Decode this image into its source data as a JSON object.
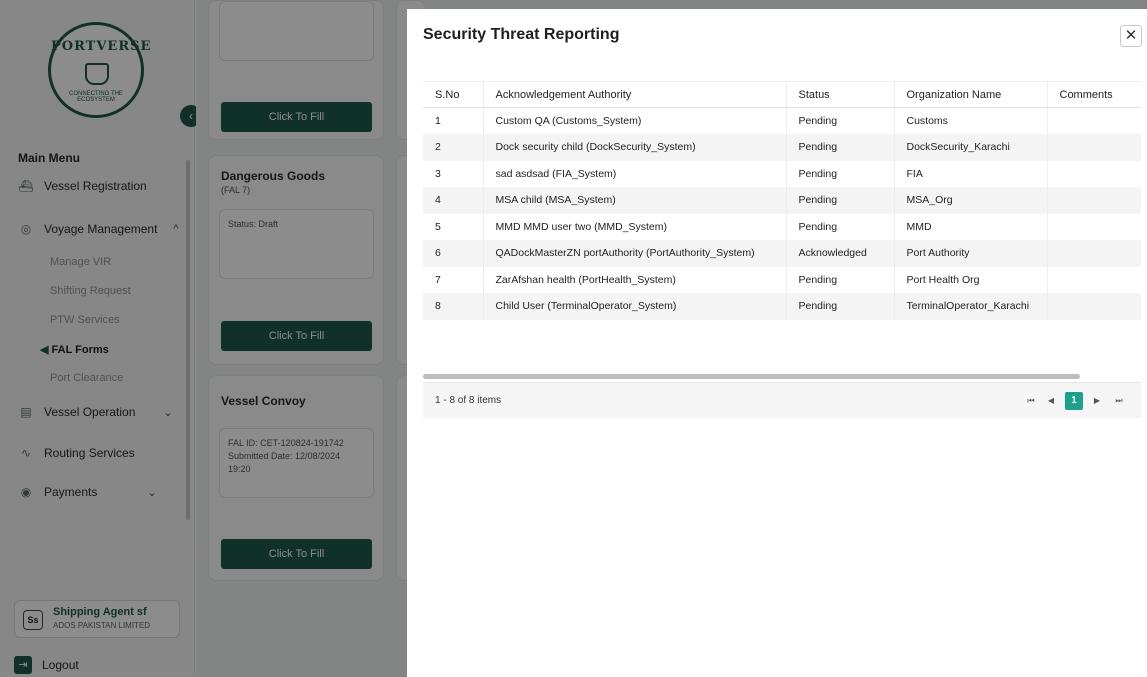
{
  "sidebar": {
    "logo_top": "PORTVERSE",
    "logo_bottom": "CONNECTING THE ECOSYSTEM",
    "menu_title": "Main Menu",
    "items": [
      {
        "label": "Vessel Registration",
        "icon": "ship-icon"
      },
      {
        "label": "Voyage Management",
        "icon": "voyage-icon",
        "chevron": "^"
      },
      {
        "label": "Vessel Operation",
        "icon": "crane-icon",
        "chevron": "⌄"
      },
      {
        "label": "Routing Services",
        "icon": "route-icon"
      },
      {
        "label": "Payments",
        "icon": "payment-icon",
        "chevron": "⌄"
      }
    ],
    "sub_items": [
      "Manage VIR",
      "Shifting Request",
      "PTW Services",
      "FAL Forms",
      "Port Clearance"
    ],
    "user": {
      "initials": "Ss",
      "name": "Shipping Agent sf",
      "org": "ADOS PAKISTAN LIMITED"
    },
    "logout_label": "Logout"
  },
  "cards": {
    "fill_label": "Click To Fill",
    "dangerous_goods": {
      "title": "Dangerous Goods",
      "sub": "(FAL 7)",
      "status": "Status: Draft"
    },
    "vessel_convoy": {
      "title": "Vessel Convoy",
      "fal_id": "FAL ID: CET-120824-191742",
      "submitted": "Submitted Date: 12/08/2024",
      "time": "19:20"
    }
  },
  "modal": {
    "title": "Security Threat Reporting",
    "close_glyph": "✕",
    "columns": [
      "S.No",
      "Acknowledgement Authority",
      "Status",
      "Organization Name",
      "Comments"
    ],
    "rows": [
      [
        "1",
        "Custom QA (Customs_System)",
        "Pending",
        "Customs",
        ""
      ],
      [
        "2",
        "Dock security child (DockSecurity_System)",
        "Pending",
        "DockSecurity_Karachi",
        ""
      ],
      [
        "3",
        "sad asdsad (FIA_System)",
        "Pending",
        "FIA",
        ""
      ],
      [
        "4",
        "MSA child (MSA_System)",
        "Pending",
        "MSA_Org",
        ""
      ],
      [
        "5",
        "MMD MMD user two (MMD_System)",
        "Pending",
        "MMD",
        ""
      ],
      [
        "6",
        "QADockMasterZN portAuthority (PortAuthority_System)",
        "Acknowledged",
        "Port Authority",
        ""
      ],
      [
        "7",
        "ZarAfshan health (PortHealth_System)",
        "Pending",
        "Port Health Org",
        ""
      ],
      [
        "8",
        "Child User (TerminalOperator_System)",
        "Pending",
        "TerminalOperator_Karachi",
        ""
      ]
    ],
    "pager": {
      "info": "1 - 8 of 8 items",
      "first": "⏮",
      "prev": "◀",
      "current": "1",
      "next": "▶",
      "last": "⏭"
    }
  }
}
